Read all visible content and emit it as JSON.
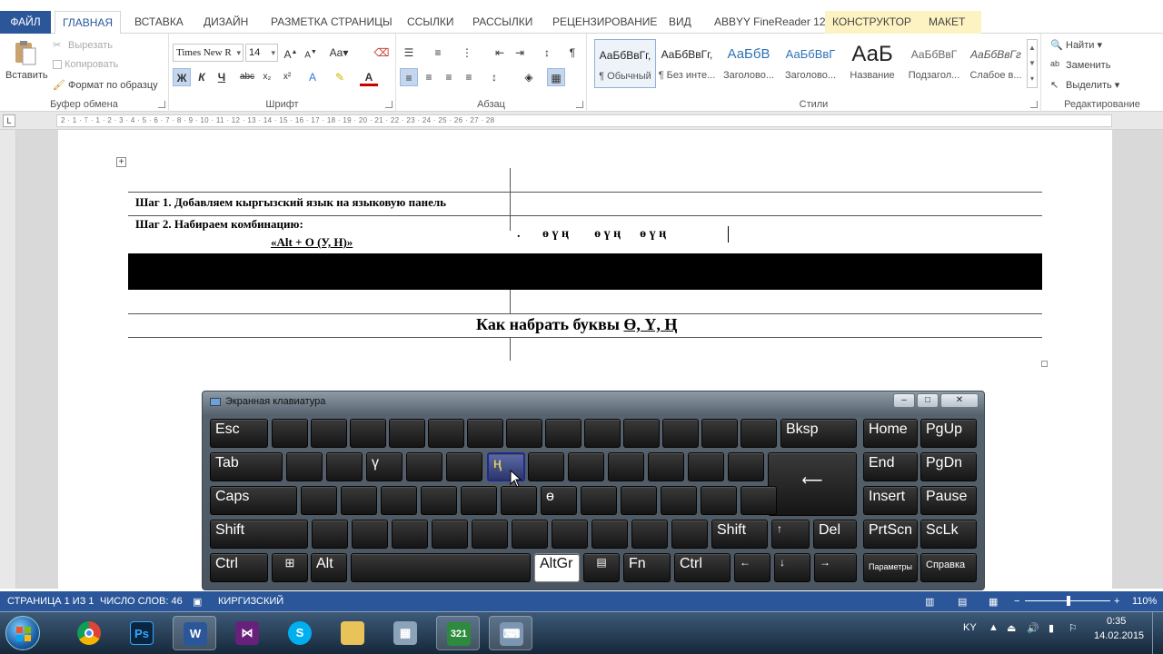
{
  "tabs": {
    "file": "ФАЙЛ",
    "items": [
      "ГЛАВНАЯ",
      "ВСТАВКА",
      "ДИЗАЙН",
      "РАЗМЕТКА СТРАНИЦЫ",
      "ССЫЛКИ",
      "РАССЫЛКИ",
      "РЕЦЕНЗИРОВАНИЕ",
      "ВИД",
      "ABBYY FineReader 12",
      "КОНСТРУКТОР",
      "МАКЕТ"
    ]
  },
  "clipboard": {
    "paste": "Вставить",
    "cut": "Вырезать",
    "copy": "Копировать",
    "format_painter": "Формат по образцу",
    "label": "Буфер обмена"
  },
  "font": {
    "name": "Times New R",
    "size": "14",
    "bold": "Ж",
    "italic": "К",
    "underline": "Ч",
    "strike": "abc",
    "sub": "x₂",
    "sup": "x²",
    "label": "Шрифт"
  },
  "paragraph": {
    "label": "Абзац"
  },
  "styles": {
    "label": "Стили",
    "items": [
      {
        "preview": "АаБбВвГг,",
        "name": "¶ Обычный"
      },
      {
        "preview": "АаБбВвГг,",
        "name": "¶ Без инте..."
      },
      {
        "preview": "АаБбВ",
        "name": "Заголово..."
      },
      {
        "preview": "АаБбВвГ",
        "name": "Заголово..."
      },
      {
        "preview": "АаБ",
        "name": "Название"
      },
      {
        "preview": "АаБбВвГ",
        "name": "Подзагол..."
      },
      {
        "preview": "АаБбВвГг",
        "name": "Слабое в..."
      }
    ]
  },
  "editing": {
    "find": "Найти",
    "replace": "Заменить",
    "select": "Выделить",
    "label": "Редактирование"
  },
  "ruler_ticks": "2 · 1 · ⟙ · 1 · 2 · 3 · 4 · 5 · 6 · 7 · 8 · 9 · 10 · 11 · 12 · 13 · 14 · 15 · 16 · 17 · 18 · 19 · 20 · 21 · 22 · 23 · 24 · 25 · 26 · 27 · 28",
  "document": {
    "step1": "Шаг 1. Добавляем кыргызский язык на языковую панель",
    "step2_line1": "Шаг 2. Набираем комбинацию:",
    "step2_line2": "«Alt + О (У, Н)»",
    "typed": ".       ө ү ң        ө ү ң      ө ү ң",
    "heading_prefix": "Как набрать буквы ",
    "heading_letters": "Ө, Ү, Ң"
  },
  "osk": {
    "title": "Экранная клавиатура",
    "keys": {
      "esc": "Esc",
      "bksp": "Bksp",
      "home": "Home",
      "pgup": "PgUp",
      "tab": "Tab",
      "y": "ү",
      "n": "ң",
      "end": "End",
      "pgdn": "PgDn",
      "caps": "Caps",
      "o": "ө",
      "insert": "Insert",
      "pause": "Pause",
      "shift": "Shift",
      "shift_r": "Shift",
      "up": "↑",
      "del": "Del",
      "prtscn": "PrtScn",
      "sclk": "ScLk",
      "ctrl": "Ctrl",
      "alt": "Alt",
      "altgr": "AltGr",
      "fn": "Fn",
      "ctrl_r": "Ctrl",
      "left": "←",
      "down": "↓",
      "right": "→",
      "options": "Параметры",
      "help": "Справка",
      "enter": "⟵"
    }
  },
  "status": {
    "page": "СТРАНИЦА 1 ИЗ 1",
    "words": "ЧИСЛО СЛОВ: 46",
    "lang": "КИРГИЗСКИЙ",
    "zoom": "110%"
  },
  "taskbar": {
    "lang": "KY",
    "time": "0:35",
    "date": "14.02.2015",
    "apps": [
      "Chrome",
      "Ps",
      "W",
      "VS",
      "S",
      "Explorer",
      "Calc",
      "321",
      "Keyboard"
    ]
  }
}
